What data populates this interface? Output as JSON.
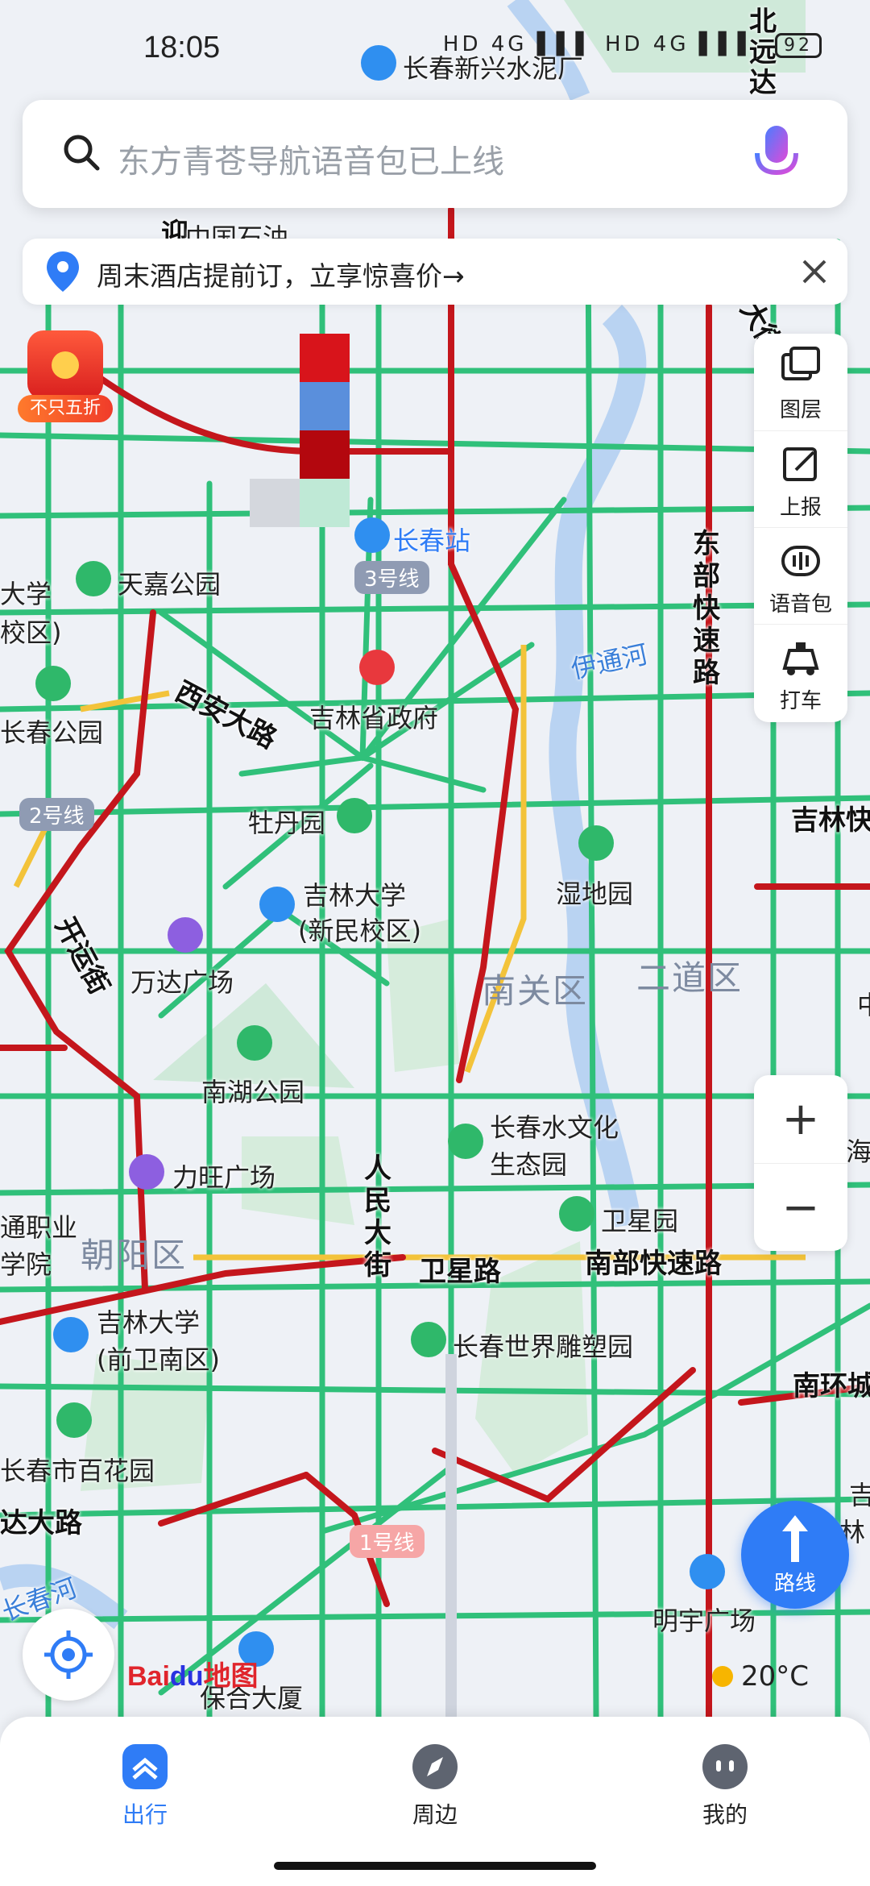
{
  "status_bar": {
    "time": "18:05",
    "network": "HD 4G ▌▌▌ HD 4G ▌▌▌",
    "battery": "92"
  },
  "search": {
    "placeholder": "东方青苍导航语音包已上线"
  },
  "promo": {
    "text": "周末酒店提前订，立享惊喜价→"
  },
  "red_packet": {
    "label": "不只五折"
  },
  "tools": [
    {
      "label": "图层",
      "icon": "layers-icon"
    },
    {
      "label": "上报",
      "icon": "report-icon"
    },
    {
      "label": "语音包",
      "icon": "voice-pack-icon"
    },
    {
      "label": "打车",
      "icon": "taxi-icon"
    }
  ],
  "zoom": {
    "in": "+",
    "out": "−"
  },
  "route_button": {
    "label": "路线"
  },
  "logo": {
    "bai": "Bai",
    "du": "du",
    "map": "地图"
  },
  "weather": {
    "temperature": "20°C"
  },
  "bottom_nav": [
    {
      "label": "出行",
      "icon": "travel-icon",
      "active": true
    },
    {
      "label": "周边",
      "icon": "compass-icon",
      "active": false
    },
    {
      "label": "我的",
      "icon": "profile-icon",
      "active": false
    }
  ],
  "map": {
    "districts": [
      "南关区",
      "二道区",
      "朝阳区"
    ],
    "roads": [
      "西安大路",
      "开运街",
      "东部快速路",
      "人民大街",
      "卫星路",
      "南部快速路",
      "南环城",
      "达大路",
      "北远达",
      "大街",
      "吉林快",
      "迎"
    ],
    "line_badges": [
      "3号线",
      "2号线",
      "1号线"
    ],
    "places": [
      "长春新兴水泥厂",
      "中国石油",
      "长春站",
      "天嘉公园",
      "大学",
      "校区)",
      "吉林省政府",
      "伊通河",
      "长春公园",
      "牡丹园",
      "湿地园",
      "吉林大学",
      "(新民校区)",
      "万达广场",
      "南湖公园",
      "长春水文化",
      "生态园",
      "力旺广场",
      "卫星园",
      "吉林大学",
      "(前卫南区)",
      "长春世界雕塑园",
      "长春市百花园",
      "明宇广场",
      "保合大厦",
      "通职业",
      "学院",
      "吉林",
      "海",
      "吉",
      "中",
      "长春河"
    ]
  }
}
